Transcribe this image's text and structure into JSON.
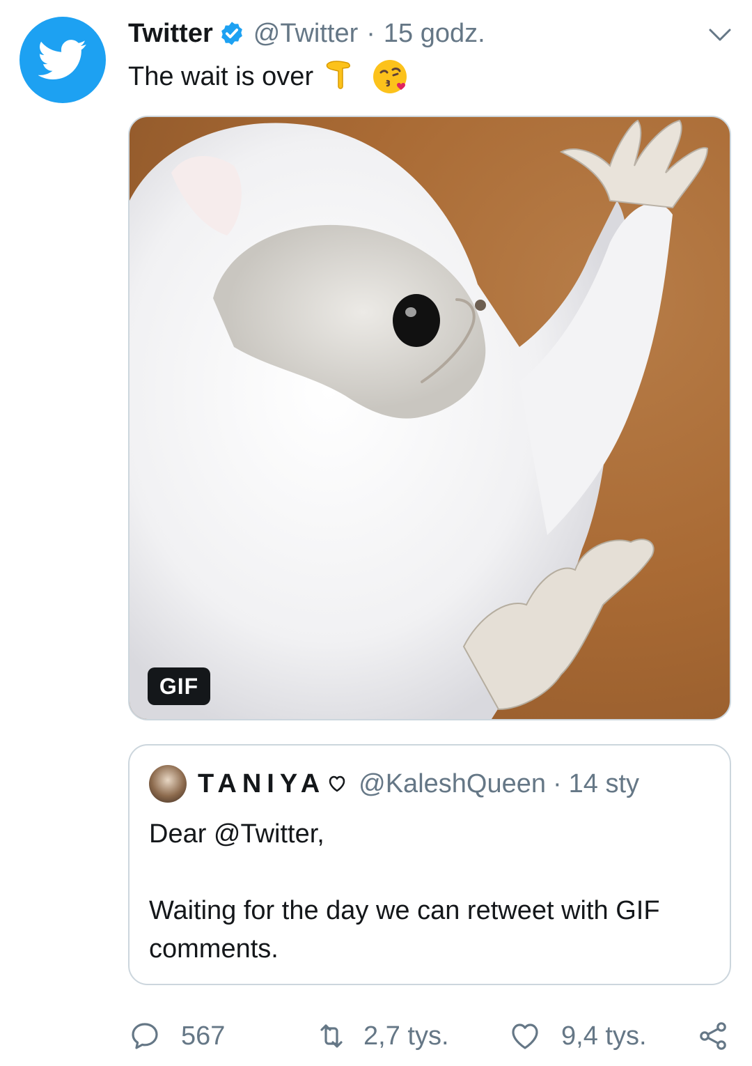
{
  "tweet": {
    "display_name": "Twitter",
    "handle": "@Twitter",
    "separator": "·",
    "time": "15 godz.",
    "text": "The wait is over",
    "emojis": [
      "backhand-index-pointing-down",
      "face-blowing-a-kiss"
    ],
    "verified": true
  },
  "media": {
    "badge": "GIF"
  },
  "quoted_tweet": {
    "display_name": "TANIYA",
    "handle": "@KaleshQueen",
    "separator": "·",
    "time": "14 sty",
    "line1": "Dear @Twitter,",
    "line2": "Waiting for the day we can retweet with GIF comments."
  },
  "actions": {
    "replies": "567",
    "retweets": "2,7 tys.",
    "likes": "9,4 tys."
  },
  "colors": {
    "brand_blue": "#1da1f2",
    "muted_text": "#657786",
    "border": "#ccd6dd"
  }
}
